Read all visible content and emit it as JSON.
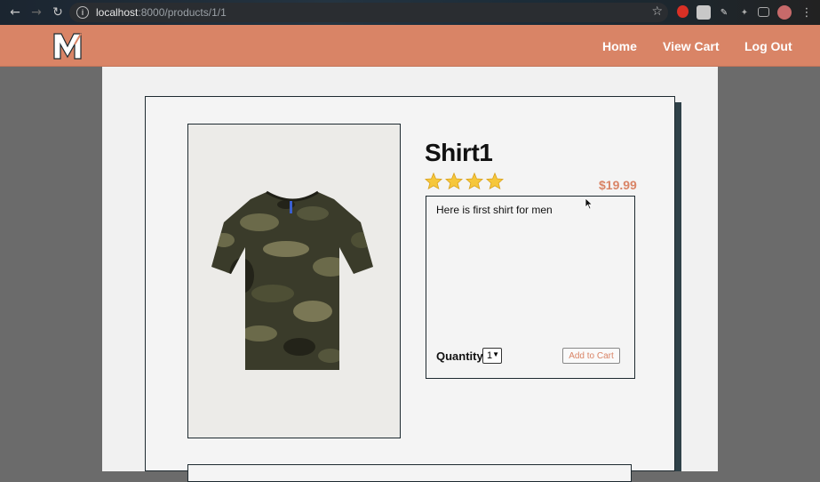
{
  "browser": {
    "url_host": "localhost",
    "url_path": ":8000/products/1/1"
  },
  "header": {
    "logo_text": "M",
    "nav": [
      {
        "label": "Home"
      },
      {
        "label": "View Cart"
      },
      {
        "label": "Log Out"
      }
    ]
  },
  "product": {
    "title": "Shirt1",
    "rating": 4,
    "rating_max": 4,
    "price": "$19.99",
    "description": "Here is first shirt for men",
    "image_icon": "camo-tshirt-image"
  },
  "purchase": {
    "quantity_label": "Quantity:",
    "quantity_value": "1",
    "add_to_cart_label": "Add to Cart"
  },
  "colors": {
    "accent": "#d98466",
    "border": "#1e2a30",
    "shadow": "#2f4148"
  }
}
